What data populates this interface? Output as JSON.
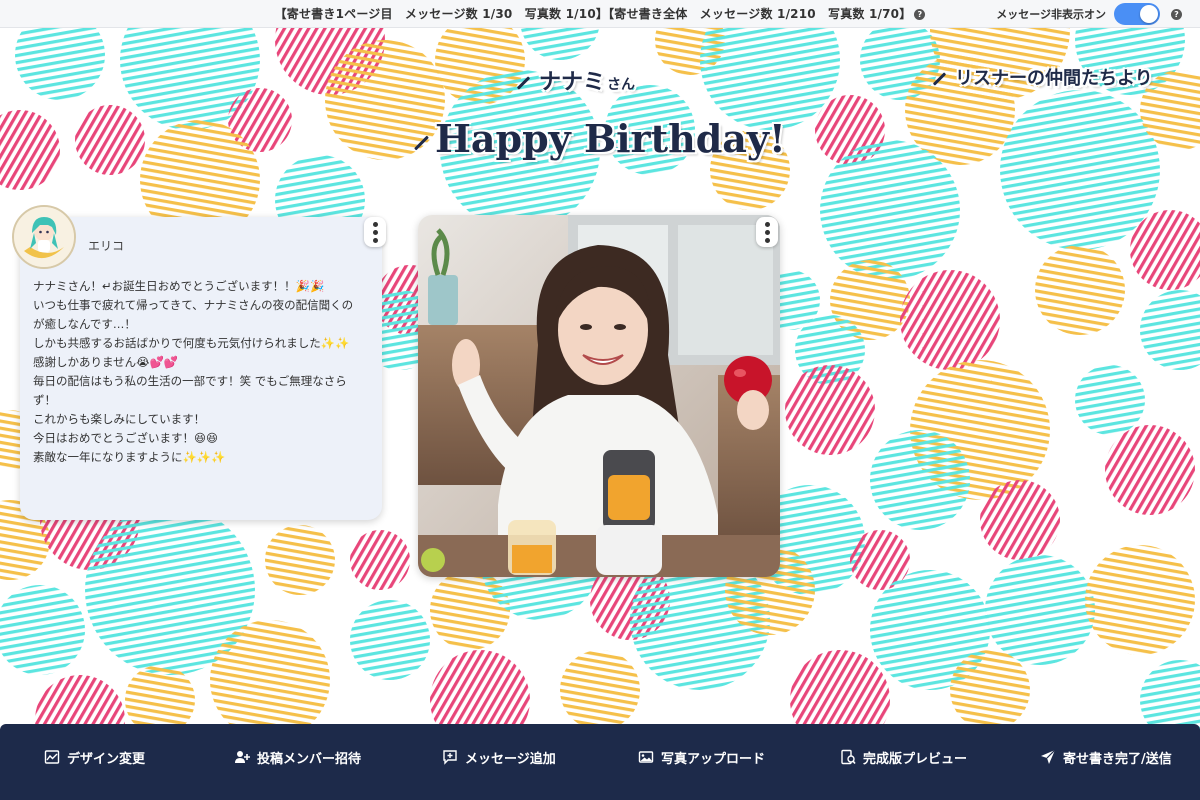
{
  "topbar": {
    "page_counts": "【寄せ書き1ページ目　メッセージ数 1/30　写真数 1/10】",
    "total_counts": "【寄せ書き全体　メッセージ数 1/210　写真数 1/70】",
    "help": "?",
    "hide_toggle_label": "メッセージ非表示オン",
    "hide_toggle_on": true
  },
  "card": {
    "to_name": "ナナミ",
    "to_suffix": "さん",
    "title": "Happy Birthday!",
    "from_name": "リスナーの仲間たちより"
  },
  "message": {
    "author": "エリコ",
    "lines": [
      "ナナミさん！↵お誕生日おめでとうございます！！🎉🎉",
      "いつも仕事で疲れて帰ってきて、ナナミさんの夜の配信聞くの",
      "が癒しなんです…！",
      "しかも共感するお話ばかりで何度も元気付けられました✨✨",
      "感謝しかありません😭💕💕",
      "",
      "毎日の配信はもう私の生活の一部です！笑 でもご無理なさら",
      "ず！",
      "これからも楽しみにしています！",
      "今日はおめでとうございます！😆😆",
      "素敵な一年になりますように✨✨✨"
    ]
  },
  "toolbar": {
    "design": "デザイン変更",
    "invite": "投稿メンバー招待",
    "add_message": "メッセージ追加",
    "upload_photo": "写真アップロード",
    "preview": "完成版プレビュー",
    "send": "寄せ書き完了/送信"
  },
  "colors": {
    "navy": "#1d2a4a",
    "toggle": "#4a8ff5",
    "dot_cyan": "#5ce5e0",
    "dot_pink": "#e8467a",
    "dot_yellow": "#f5c04a"
  },
  "icons": [
    "pen-icon",
    "kebab-icon",
    "help-icon",
    "design-icon",
    "invite-icon",
    "add-message-icon",
    "photo-upload-icon",
    "preview-icon",
    "send-icon"
  ]
}
